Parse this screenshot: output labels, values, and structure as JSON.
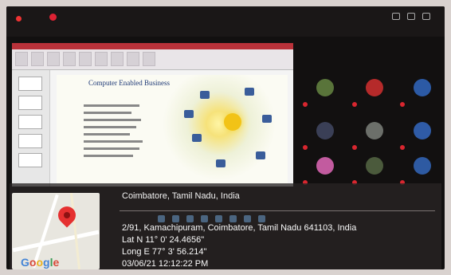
{
  "geotag": {
    "place": "Coimbatore, Tamil Nadu, India",
    "address": "2/91, Kamachipuram, Coimbatore, Tamil Nadu 641103, India",
    "latitude": "Lat N 11° 0' 24.4656\"",
    "longitude": "Long E 77° 3' 56.214\"",
    "datetime": "03/06/21 12:12:22 PM"
  },
  "slide": {
    "title": "Computer Enabled Business"
  },
  "map": {
    "brand": "Google",
    "pin_color": "#e53030"
  },
  "colors": {
    "record_red": "#e33333",
    "overlay_bg": "#2a2626"
  },
  "icons": [
    "record-icon",
    "presenter-icon",
    "map-pin-icon",
    "participant-avatar-icon",
    "mic-muted-icon"
  ]
}
